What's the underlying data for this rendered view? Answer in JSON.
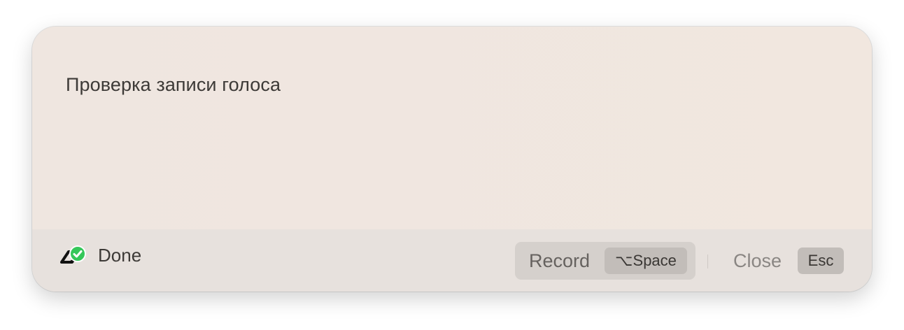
{
  "window": {
    "transcript_text": "Проверка записи голоса"
  },
  "footer": {
    "status": {
      "icon": "done-check-icon",
      "label": "Done",
      "accent": "#35c759"
    },
    "record": {
      "label": "Record",
      "shortcut": "⌥Space"
    },
    "close": {
      "label": "Close",
      "shortcut": "Esc"
    }
  }
}
